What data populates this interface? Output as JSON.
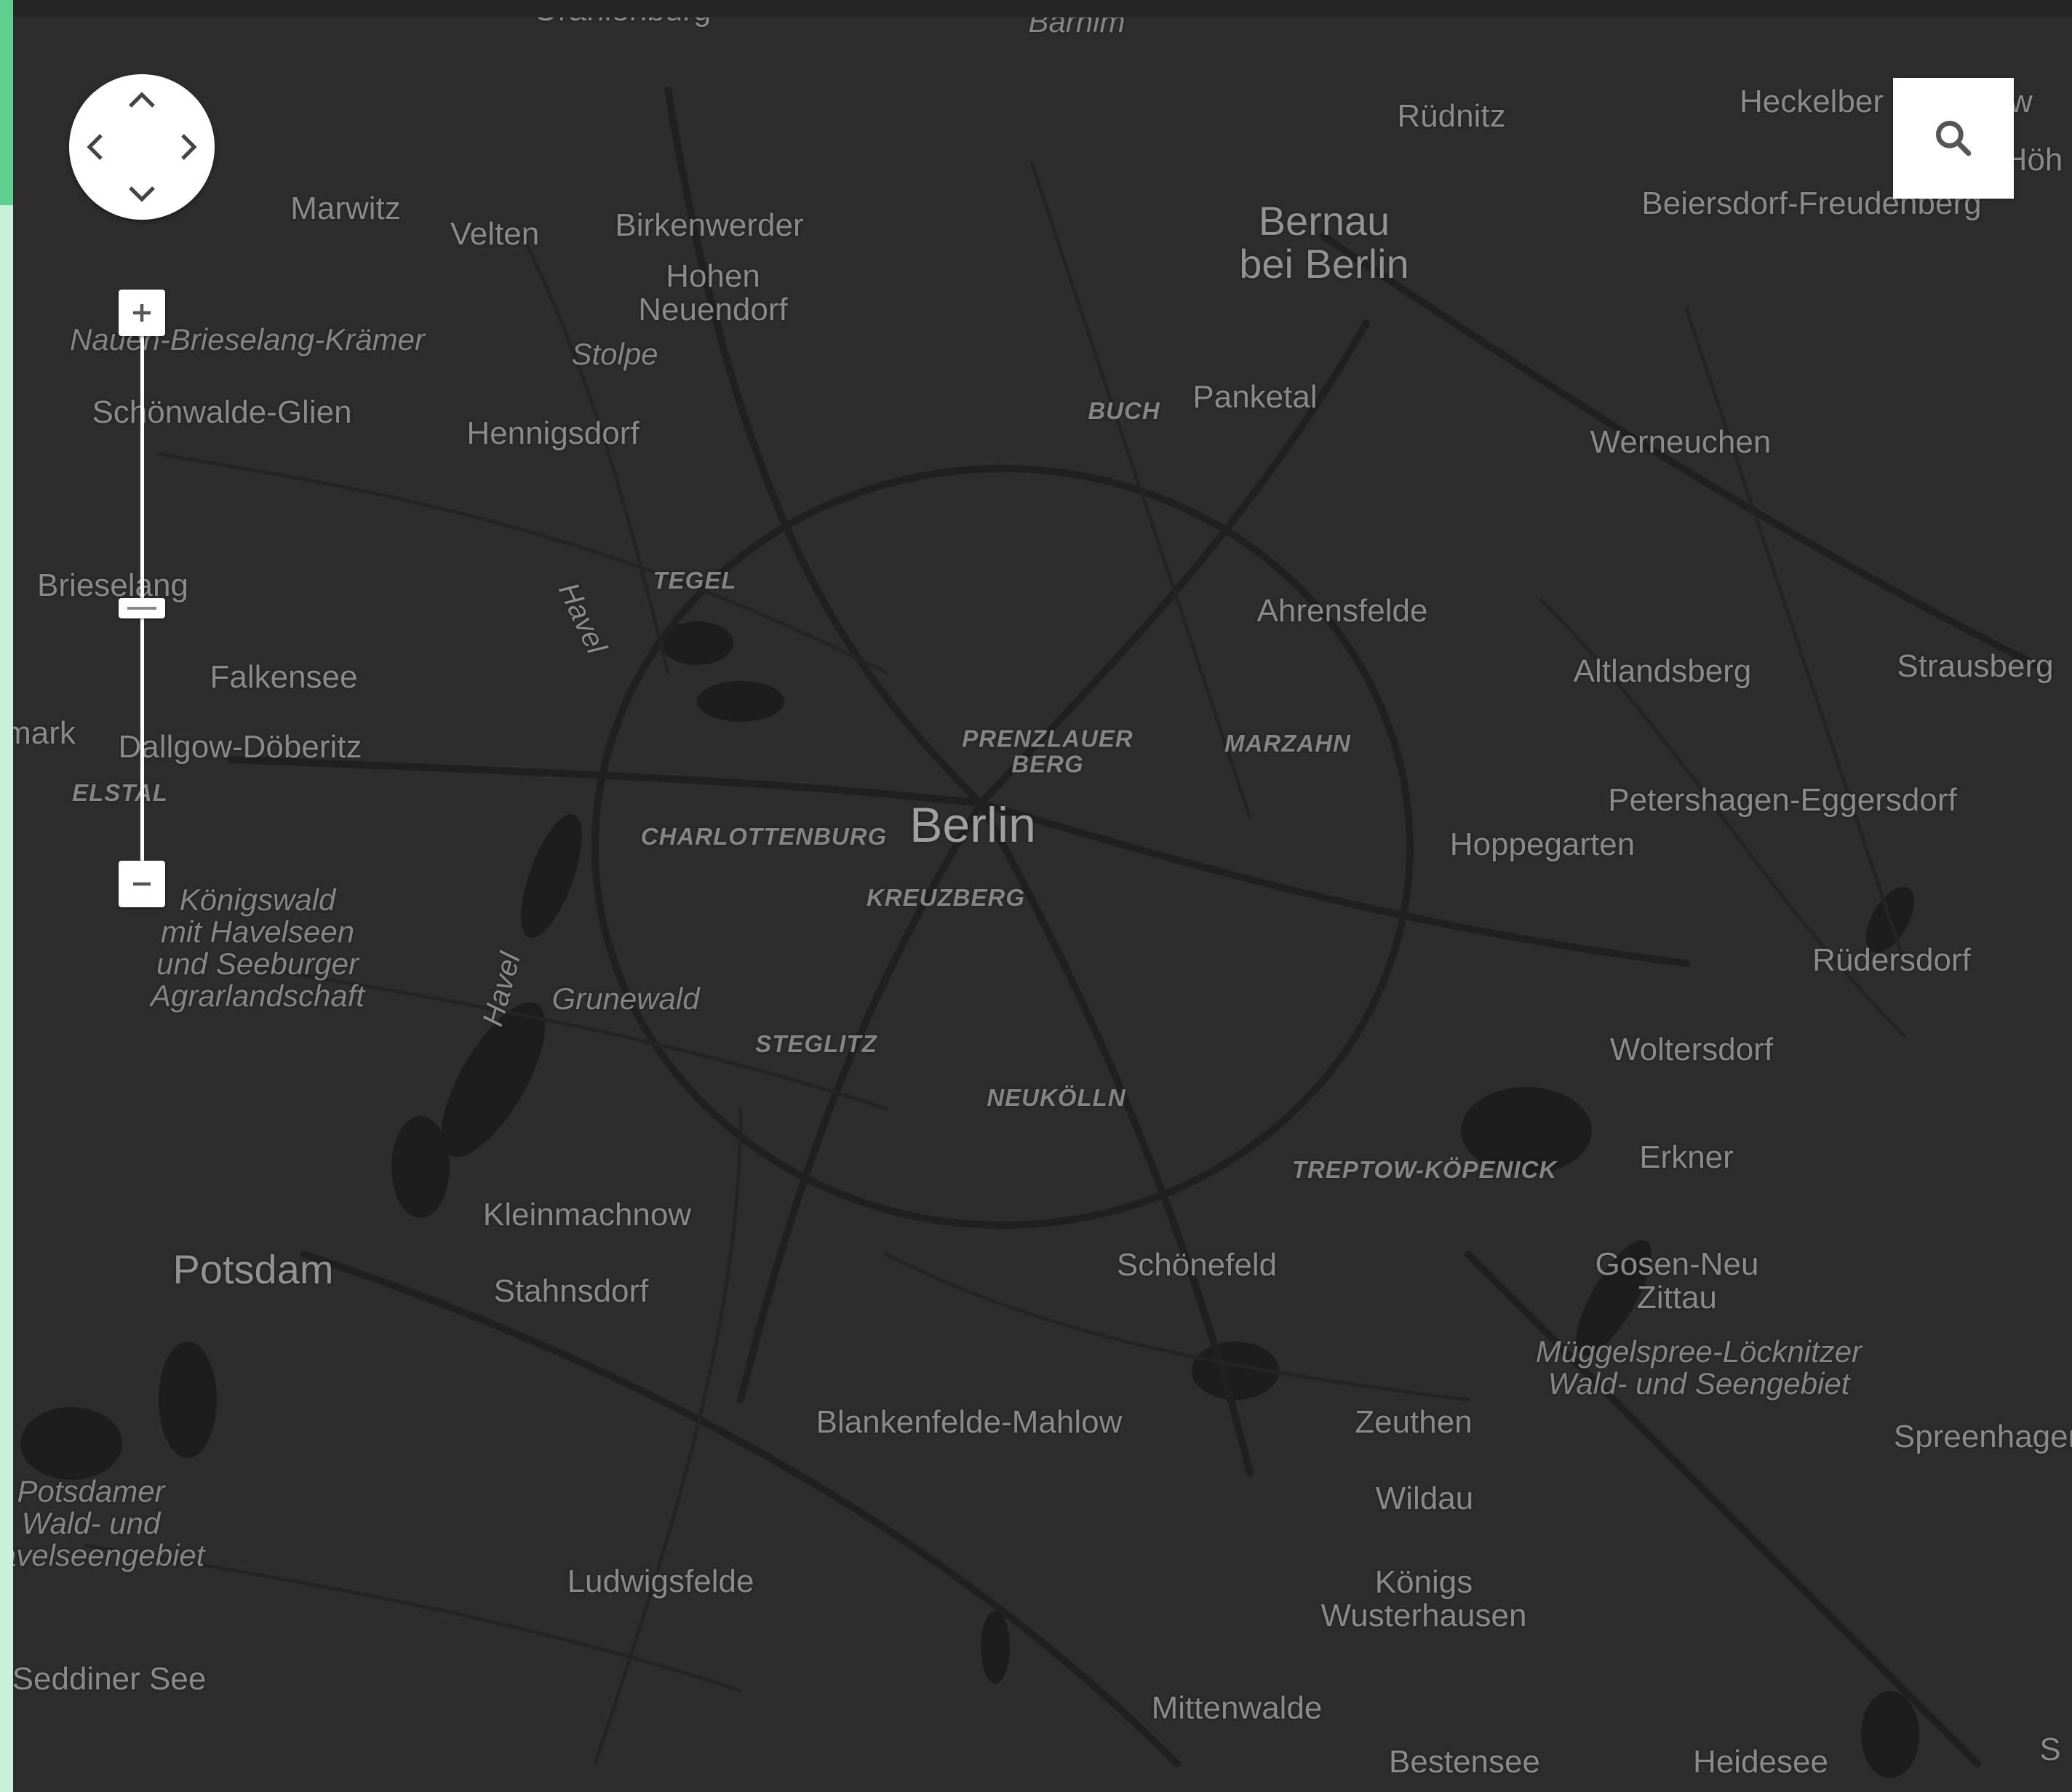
{
  "map": {
    "center_label": "Berlin",
    "labels": [
      {
        "text": "Oranienburg",
        "kind": "town"
      },
      {
        "text": "Barnim",
        "kind": "region"
      },
      {
        "text": "Rüdnitz",
        "kind": "town"
      },
      {
        "text": "Heckelber",
        "kind": "town"
      },
      {
        "text": "w",
        "kind": "town"
      },
      {
        "text": "Höh",
        "kind": "town"
      },
      {
        "text": "Beiersdorf-Freudenberg",
        "kind": "town"
      },
      {
        "text": "Marwitz",
        "kind": "town"
      },
      {
        "text": "Velten",
        "kind": "town"
      },
      {
        "text": "Birkenwerder",
        "kind": "town"
      },
      {
        "text": "Hohen\nNeuendorf",
        "kind": "town"
      },
      {
        "text": "Bernau\nbei Berlin",
        "kind": "bigtown"
      },
      {
        "text": "Nauen-Brieselang-Krämer",
        "kind": "nature"
      },
      {
        "text": "Stolpe",
        "kind": "nature"
      },
      {
        "text": "Schönwalde-Glien",
        "kind": "town"
      },
      {
        "text": "Hennigsdorf",
        "kind": "town"
      },
      {
        "text": "BUCH",
        "kind": "district"
      },
      {
        "text": "Panketal",
        "kind": "town"
      },
      {
        "text": "Werneuchen",
        "kind": "town"
      },
      {
        "text": "TEGEL",
        "kind": "district"
      },
      {
        "text": "Havel",
        "kind": "water"
      },
      {
        "text": "Brieselang",
        "kind": "town"
      },
      {
        "text": "Ahrensfelde",
        "kind": "town"
      },
      {
        "text": "Falkensee",
        "kind": "town"
      },
      {
        "text": "Altlandsberg",
        "kind": "town"
      },
      {
        "text": "Strausberg",
        "kind": "town"
      },
      {
        "text": "mark",
        "kind": "town"
      },
      {
        "text": "Dallgow-Döberitz",
        "kind": "town"
      },
      {
        "text": "PRENZLAUER\nBERG",
        "kind": "district"
      },
      {
        "text": "MARZAHN",
        "kind": "district"
      },
      {
        "text": "ELSTAL",
        "kind": "district"
      },
      {
        "text": "Petershagen-Eggersdorf",
        "kind": "town"
      },
      {
        "text": "CHARLOTTENBURG",
        "kind": "district"
      },
      {
        "text": "Berlin",
        "kind": "capital"
      },
      {
        "text": "Hoppegarten",
        "kind": "town"
      },
      {
        "text": "KREUZBERG",
        "kind": "district"
      },
      {
        "text": "Königswald\nmit Havelseen\nund Seeburger\nAgrarlandschaft",
        "kind": "nature"
      },
      {
        "text": "Havel",
        "kind": "water"
      },
      {
        "text": "Grunewald",
        "kind": "nature"
      },
      {
        "text": "Rüdersdorf",
        "kind": "town"
      },
      {
        "text": "STEGLITZ",
        "kind": "district"
      },
      {
        "text": "Woltersdorf",
        "kind": "town"
      },
      {
        "text": "NEUKÖLLN",
        "kind": "district"
      },
      {
        "text": "Erkner",
        "kind": "town"
      },
      {
        "text": "TREPTOW-KÖPENICK",
        "kind": "district"
      },
      {
        "text": "Kleinmachnow",
        "kind": "town"
      },
      {
        "text": "Potsdam",
        "kind": "bigtown"
      },
      {
        "text": "Schönefeld",
        "kind": "town"
      },
      {
        "text": "Gosen-Neu\nZittau",
        "kind": "town"
      },
      {
        "text": "Stahnsdorf",
        "kind": "town"
      },
      {
        "text": "Müggelspree-Löcknitzer\nWald- und Seengebiet",
        "kind": "nature"
      },
      {
        "text": "Blankenfelde-Mahlow",
        "kind": "town"
      },
      {
        "text": "Zeuthen",
        "kind": "town"
      },
      {
        "text": "Spreenhagen",
        "kind": "town"
      },
      {
        "text": "Potsdamer\nWald- und\nHavelseengebiet",
        "kind": "nature"
      },
      {
        "text": "Wildau",
        "kind": "town"
      },
      {
        "text": "Ludwigsfelde",
        "kind": "town"
      },
      {
        "text": "Königs\nWusterhausen",
        "kind": "town"
      },
      {
        "text": "Seddiner See",
        "kind": "town"
      },
      {
        "text": "Mittenwalde",
        "kind": "town"
      },
      {
        "text": "Bestensee",
        "kind": "town"
      },
      {
        "text": "Heidesee",
        "kind": "town"
      },
      {
        "text": "S",
        "kind": "town"
      }
    ]
  },
  "controls": {
    "pan": {
      "icons": [
        "chevron-up-icon",
        "chevron-down-icon",
        "chevron-left-icon",
        "chevron-right-icon"
      ]
    },
    "zoom": {
      "in_icon": "plus-icon",
      "out_icon": "minus-icon",
      "level": 0.63
    },
    "search": {
      "icon": "search-icon"
    }
  },
  "colors": {
    "map_background": "#2d2d2d",
    "road": "#1f1f1f",
    "water": "#1c1c1c",
    "label": "#8a8a8a",
    "accent": "#5fcf8e",
    "accent_light": "#c9f0da",
    "control": "#ffffff"
  }
}
